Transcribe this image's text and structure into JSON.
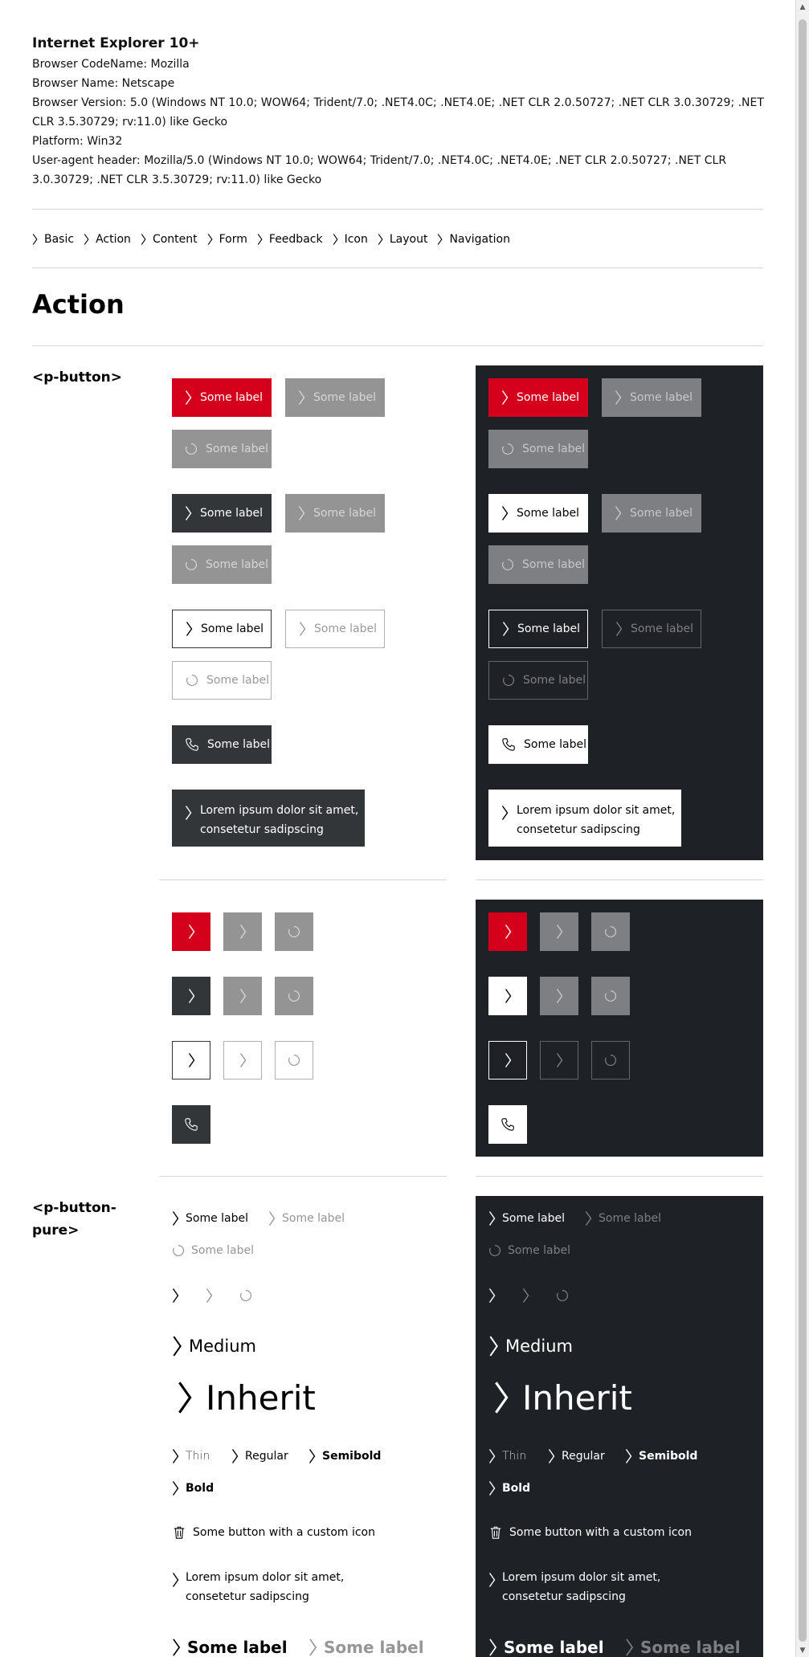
{
  "browser_info": {
    "title": "Internet Explorer 10+",
    "code_name": "Browser CodeName: Mozilla",
    "name": "Browser Name: Netscape",
    "version": "Browser Version: 5.0 (Windows NT 10.0; WOW64; Trident/7.0; .NET4.0C; .NET4.0E; .NET CLR 2.0.50727; .NET CLR 3.0.30729; .NET CLR 3.5.30729; rv:11.0) like Gecko",
    "platform": "Platform: Win32",
    "user_agent": "User-agent header: Mozilla/5.0 (Windows NT 10.0; WOW64; Trident/7.0; .NET4.0C; .NET4.0E; .NET CLR 2.0.50727; .NET CLR 3.0.30729; .NET CLR 3.5.30729; rv:11.0) like Gecko"
  },
  "nav": {
    "items": [
      "Basic",
      "Action",
      "Content",
      "Form",
      "Feedback",
      "Icon",
      "Layout",
      "Navigation"
    ]
  },
  "page_title": "Action",
  "sections": {
    "button": "<p-button>",
    "button_pure": "<p-button-pure>"
  },
  "labels": {
    "some_label": "Some label",
    "lorem_line1": "Lorem ipsum dolor sit amet,",
    "lorem_line2": "consetetur sadipscing",
    "medium": "Medium",
    "inherit": "Inherit",
    "thin": "Thin",
    "regular": "Regular",
    "semibold": "Semibold",
    "bold": "Bold",
    "custom_icon": "Some button with a custom icon"
  },
  "colors": {
    "brand_red": "#d5001c",
    "dark_theme_bg": "#1e2126",
    "tertiary": "#323639",
    "disabled": "#949494"
  },
  "icons": [
    "arrow-head-right-icon",
    "spinner-icon",
    "phone-icon",
    "delete-icon"
  ]
}
